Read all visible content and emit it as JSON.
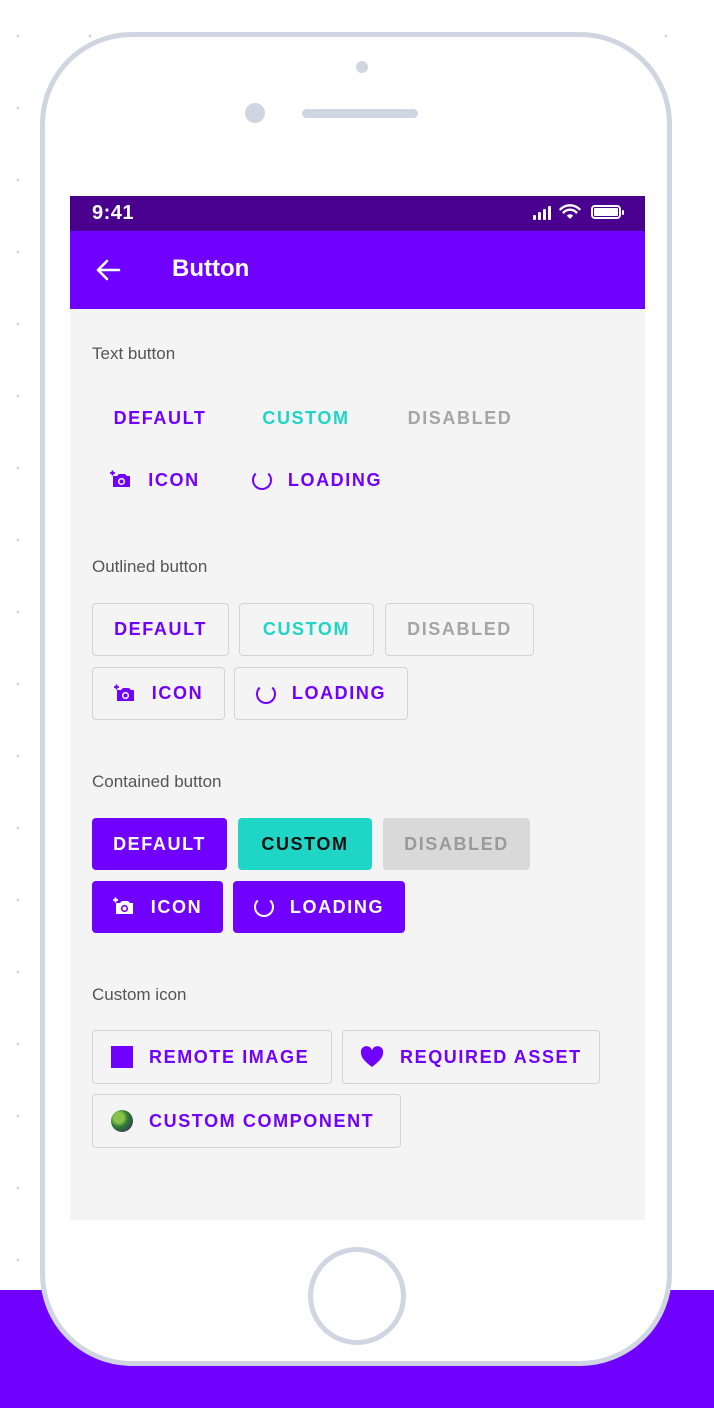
{
  "status_bar": {
    "time": "9:41"
  },
  "app_bar": {
    "title": "Button"
  },
  "sections": {
    "text": {
      "title": "Text button",
      "default": "DEFAULT",
      "custom": "CUSTOM",
      "disabled": "DISABLED",
      "icon": "ICON",
      "loading": "LOADING"
    },
    "outlined": {
      "title": "Outlined button",
      "default": "DEFAULT",
      "custom": "CUSTOM",
      "disabled": "DISABLED",
      "icon": "ICON",
      "loading": "LOADING"
    },
    "contained": {
      "title": "Contained button",
      "default": "DEFAULT",
      "custom": "CUSTOM",
      "disabled": "DISABLED",
      "icon": "ICON",
      "loading": "LOADING"
    },
    "custom_icon": {
      "title": "Custom icon",
      "remote_image": "REMOTE IMAGE",
      "required_asset": "REQUIRED ASSET",
      "custom_component": "CUSTOM COMPONENT"
    }
  },
  "colors": {
    "primary": "#7000ff",
    "status_bar": "#4a008f",
    "custom": "#1ed5c6",
    "disabled_text": "#a5a5a5",
    "screen_bg": "#f4f4f4"
  },
  "icons": [
    "back-arrow-icon",
    "signal-icon",
    "wifi-icon",
    "battery-icon",
    "camera-icon",
    "spinner-icon",
    "square-icon",
    "heart-icon",
    "globe-icon"
  ]
}
